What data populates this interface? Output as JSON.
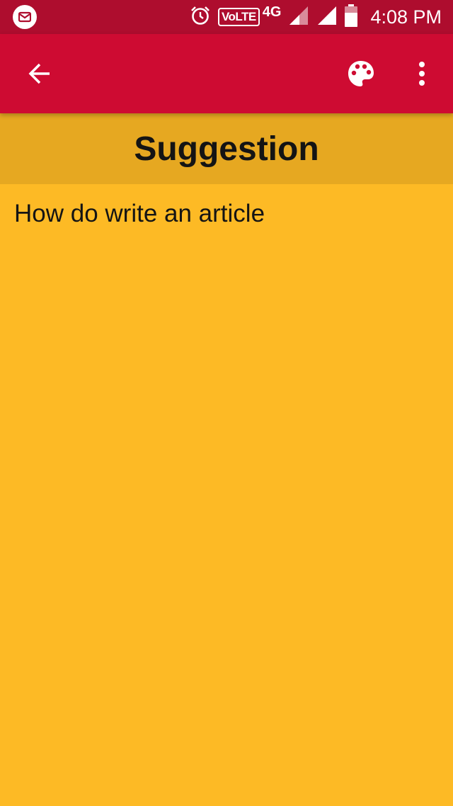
{
  "status_bar": {
    "volte_label": "VoLTE",
    "network_type": "4G",
    "time": "4:08 PM",
    "icons": [
      "mail-icon",
      "alarm-icon",
      "signal-icon",
      "battery-icon"
    ]
  },
  "app_bar": {
    "background_color": "#CE0B32",
    "icons": [
      "back-arrow-icon",
      "palette-icon",
      "more-vert-icon"
    ]
  },
  "note": {
    "title": "Suggestion",
    "body": "How do write an article",
    "background_color": "#FDBA25",
    "header_color": "#E6A821"
  }
}
